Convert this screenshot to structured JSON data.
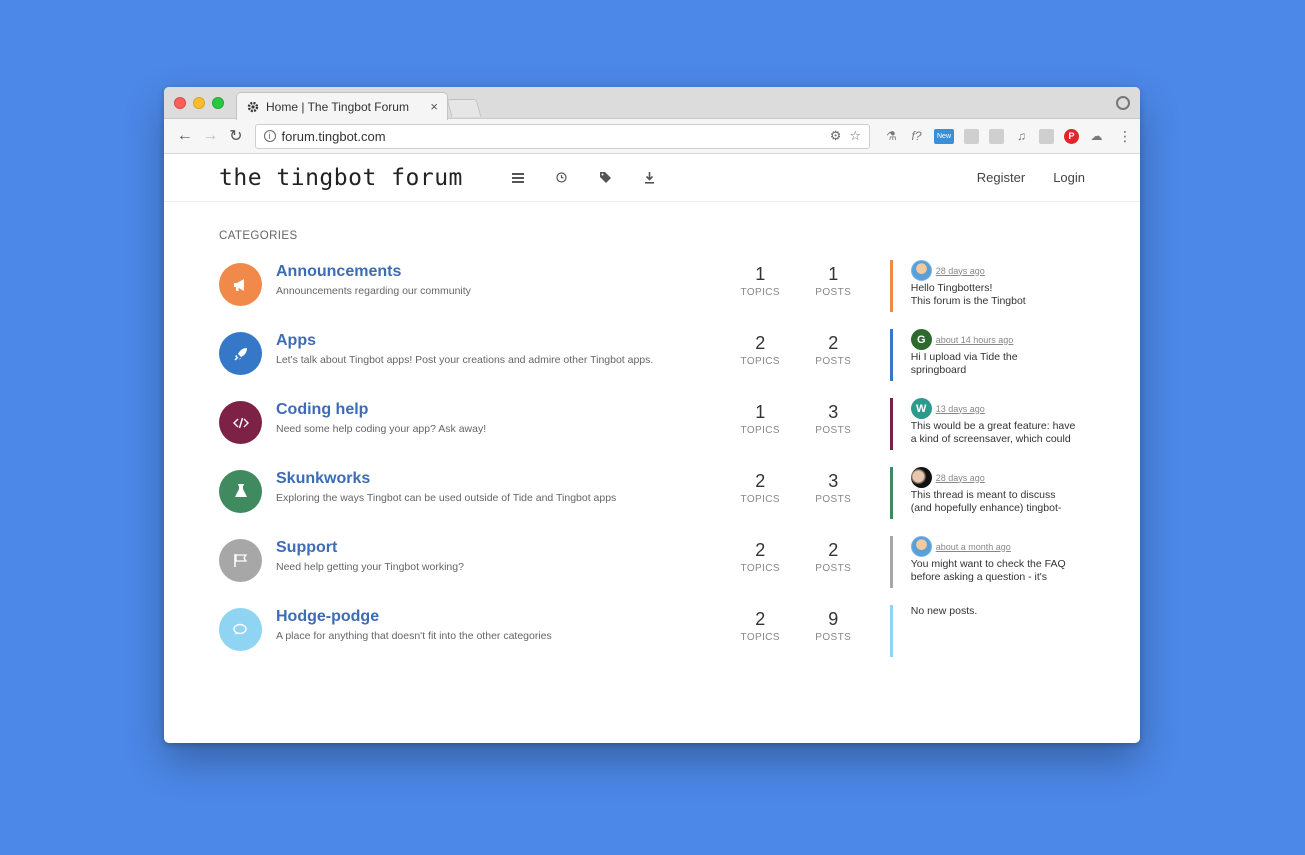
{
  "browser": {
    "tab_title": "Home | The Tingbot Forum",
    "tab_close": "×",
    "url": "forum.tingbot.com",
    "ext_new_label": "New"
  },
  "forum": {
    "logo": "the tingbot forum",
    "register": "Register",
    "login": "Login",
    "section_label": "CATEGORIES",
    "topics_label": "TOPICS",
    "posts_label": "POSTS"
  },
  "categories": [
    {
      "name": "Announcements",
      "description": "Announcements regarding our community",
      "topics": "1",
      "posts": "1",
      "color": "#f0894a",
      "icon": "megaphone-icon",
      "latest": {
        "time": "28 days ago",
        "line1": "Hello Tingbotters!",
        "line2": "This forum is the Tingbot",
        "avatar": "photo"
      }
    },
    {
      "name": "Apps",
      "description": "Let's talk about Tingbot apps! Post your creations and admire other Tingbot apps.",
      "topics": "2",
      "posts": "2",
      "color": "#3578c8",
      "icon": "rocket-icon",
      "latest": {
        "time": "about 14 hours ago",
        "line1": "Hi I upload via Tide the",
        "line2": "springboard",
        "avatar": "G"
      }
    },
    {
      "name": "Coding help",
      "description": "Need some help coding your app? Ask away!",
      "topics": "1",
      "posts": "3",
      "color": "#7d2146",
      "icon": "code-icon",
      "latest": {
        "time": "13 days ago",
        "line1": "This would be a great feature: have",
        "line2": "a kind of screensaver, which could",
        "avatar": "W"
      }
    },
    {
      "name": "Skunkworks",
      "description": "Exploring the ways Tingbot can be used outside of Tide and Tingbot apps",
      "topics": "2",
      "posts": "3",
      "color": "#3f8a5e",
      "icon": "flask-icon",
      "latest": {
        "time": "28 days ago",
        "line1": "This thread is meant to discuss",
        "line2": "(and hopefully enhance) tingbot-",
        "avatar": "photo-dark"
      }
    },
    {
      "name": "Support",
      "description": "Need help getting your Tingbot working?",
      "topics": "2",
      "posts": "2",
      "color": "#a7a7a7",
      "icon": "flag-icon",
      "latest": {
        "time": "about a month ago",
        "line1": "You might want to check the FAQ",
        "line2": "before asking a question - it's",
        "avatar": "photo"
      }
    },
    {
      "name": "Hodge-podge",
      "description": "A place for anything that doesn't fit into the other categories",
      "topics": "2",
      "posts": "9",
      "color": "#8fd4f3",
      "icon": "comments-icon",
      "latest": {
        "no_posts": "No new posts."
      }
    }
  ]
}
